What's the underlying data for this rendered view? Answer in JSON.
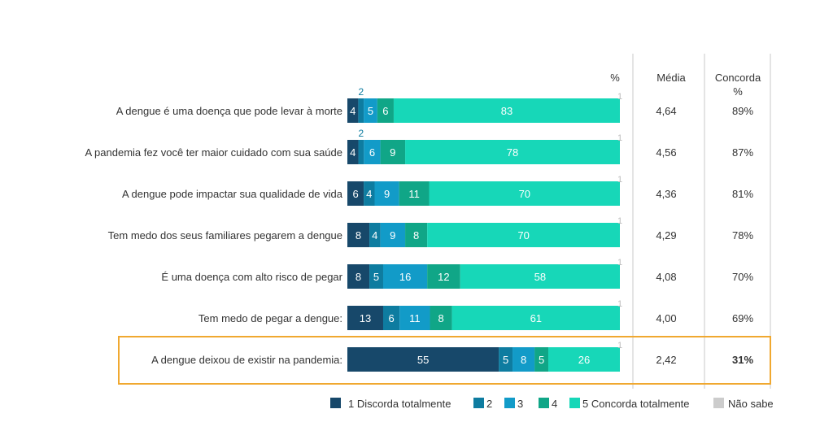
{
  "headers": {
    "percent": "%",
    "media": "Média",
    "concorda": "Concorda",
    "concorda_pct": "%"
  },
  "chart_data": {
    "type": "bar",
    "orientation": "horizontal",
    "stacked": true,
    "grid": false,
    "legend_position": "bottom-right",
    "categories": [
      "A dengue é uma doença que pode levar à morte",
      "A pandemia fez você ter maior cuidado com sua saúde",
      "A dengue pode impactar sua qualidade de vida",
      "Tem medo dos seus familiares pegarem a dengue",
      "É uma doença com alto risco de pegar",
      "Tem medo de pegar a dengue:",
      "A dengue deixou de existir na pandemia:"
    ],
    "series": [
      {
        "name": "1 Discorda totalmente",
        "color": "#17486a",
        "values": [
          4,
          4,
          6,
          8,
          8,
          13,
          55
        ]
      },
      {
        "name": "2",
        "color": "#0e7ca0",
        "values": [
          2,
          2,
          4,
          4,
          5,
          6,
          5
        ]
      },
      {
        "name": "3",
        "color": "#129bc8",
        "values": [
          5,
          6,
          9,
          9,
          16,
          11,
          8
        ]
      },
      {
        "name": "4",
        "color": "#10a687",
        "values": [
          6,
          9,
          11,
          8,
          12,
          8,
          5
        ]
      },
      {
        "name": "5 Concorda totalmente",
        "color": "#17d7b8",
        "values": [
          83,
          78,
          70,
          70,
          58,
          61,
          26
        ]
      },
      {
        "name": "Não sabe",
        "color": "#cccccc",
        "values": [
          1,
          1,
          1,
          1,
          1,
          1,
          1
        ]
      }
    ],
    "media": [
      "4,64",
      "4,56",
      "4,36",
      "4,29",
      "4,08",
      "4,00",
      "2,42"
    ],
    "concorda": [
      "89%",
      "87%",
      "81%",
      "78%",
      "70%",
      "69%",
      "31%"
    ],
    "highlight_row": 6,
    "highlight_color": "#f0a830"
  }
}
